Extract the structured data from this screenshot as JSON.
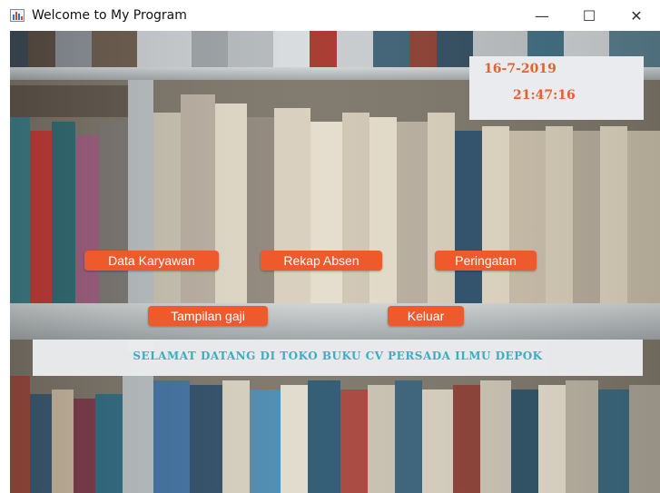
{
  "window": {
    "title": "Welcome to My Program",
    "minimize": "—",
    "maximize": "☐",
    "close": "✕"
  },
  "clock": {
    "date": "16-7-2019",
    "time": "21:47:16"
  },
  "buttons": {
    "data_karyawan": "Data Karyawan",
    "rekap_absen": "Rekap Absen",
    "peringatan": "Peringatan",
    "tampilan_gaji": "Tampilan gaji",
    "keluar": "Keluar"
  },
  "banner": {
    "text": "SELAMAT DATANG DI TOKO BUKU CV PERSADA ILMU DEPOK"
  },
  "colors": {
    "button": "#ef5a2c",
    "clock_text": "#e8602c",
    "banner_text": "#36b1c2"
  }
}
